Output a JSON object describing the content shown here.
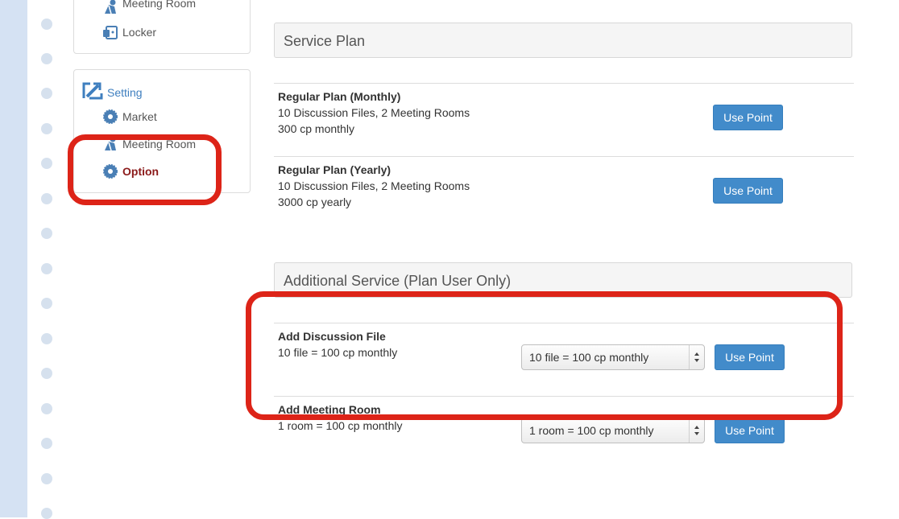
{
  "sidebar": {
    "panel1": {
      "items": [
        {
          "label": "Meeting Room",
          "icon": "person-icon"
        },
        {
          "label": "Locker",
          "icon": "locker-icon"
        }
      ]
    },
    "panel2": {
      "heading": {
        "label": "Setting",
        "icon": "setting-icon"
      },
      "items": [
        {
          "label": "Market",
          "icon": "gear-icon"
        },
        {
          "label": "Meeting Room",
          "icon": "person-icon"
        },
        {
          "label": "Option",
          "icon": "gear-icon",
          "active": true,
          "color": "#8b1a1a"
        }
      ]
    }
  },
  "service_plan": {
    "title": "Service Plan",
    "plans": [
      {
        "name": "Regular Plan (Monthly)",
        "features": "10 Discussion Files, 2 Meeting Rooms",
        "price": "300 cp monthly",
        "button": "Use Point"
      },
      {
        "name": "Regular Plan (Yearly)",
        "features": "10 Discussion Files, 2 Meeting Rooms",
        "price": "3000 cp yearly",
        "button": "Use Point"
      }
    ]
  },
  "additional_service": {
    "title": "Additional Service (Plan User Only)",
    "items": [
      {
        "name": "Add Discussion File",
        "desc": "10 file = 100 cp monthly",
        "selected": "10 file = 100 cp monthly",
        "button": "Use Point"
      },
      {
        "name": "Add Meeting Room",
        "desc": "1 room = 100 cp monthly",
        "selected": "1 room = 100 cp monthly",
        "button": "Use Point"
      }
    ]
  },
  "colors": {
    "accent": "#428bca",
    "annotation": "#dd2418",
    "left_strip": "#d5e2f3",
    "active_item": "#8b1a1a"
  }
}
